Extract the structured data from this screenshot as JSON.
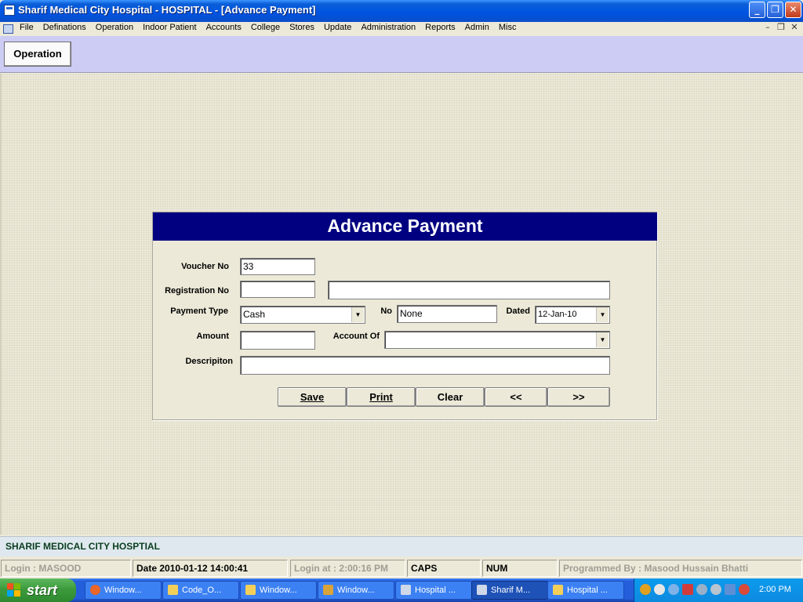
{
  "window": {
    "title": "Sharif Medical City Hospital - HOSPITAL - [Advance Payment]",
    "caption_buttons": {
      "minimize": "_",
      "restore": "❐",
      "close": "✕"
    }
  },
  "menu": {
    "items": [
      "File",
      "Definations",
      "Operation",
      "Indoor Patient",
      "Accounts",
      "College",
      "Stores",
      "Update",
      "Administration",
      "Reports",
      "Admin",
      "Misc"
    ],
    "mdi_controls": {
      "minimize": "–",
      "restore": "❐",
      "close": "✕"
    }
  },
  "toolbar": {
    "operation_label": "Operation"
  },
  "form": {
    "title": "Advance Payment",
    "voucher_no_label": "Voucher No",
    "voucher_no_value": "33",
    "registration_no_label": "Registration No",
    "registration_no_value": "",
    "registration_name_value": "",
    "payment_type_label": "Payment Type",
    "payment_type_value": "Cash",
    "no_label": "No",
    "no_value": "None",
    "dated_label": "Dated",
    "dated_value": "12-Jan-10",
    "amount_label": "Amount",
    "amount_value": "",
    "account_of_label": "Account Of",
    "account_of_value": "",
    "description_label": "Descripiton",
    "description_value": "",
    "buttons": {
      "save": "Save",
      "print": "Print",
      "clear": "Clear",
      "prev": "<<",
      "next": ">>"
    }
  },
  "brand_bar": {
    "text": "SHARIF MEDICAL CITY HOSPTIAL"
  },
  "status": {
    "login": "Login :  MASOOD",
    "date": "Date 2010-01-12 14:00:41",
    "login_at": "Login at : 2:00:16 PM",
    "caps": "CAPS",
    "num": "NUM",
    "programmer": "Programmed By : Masood Hussain Bhatti"
  },
  "taskbar": {
    "start_label": "start",
    "tasks": [
      "Window...",
      "Code_O...",
      "Window...",
      "Window...",
      "Hospital ...",
      "Sharif M...",
      "Hospital ..."
    ],
    "clock": "2:00 PM"
  },
  "colors": {
    "title_bar": "#0053e1",
    "form_header": "#000080",
    "toolbar": "#ccccf5",
    "brand_text": "#0a3e1e",
    "taskbar": "#245edb",
    "start_button": "#3c9a3c"
  }
}
